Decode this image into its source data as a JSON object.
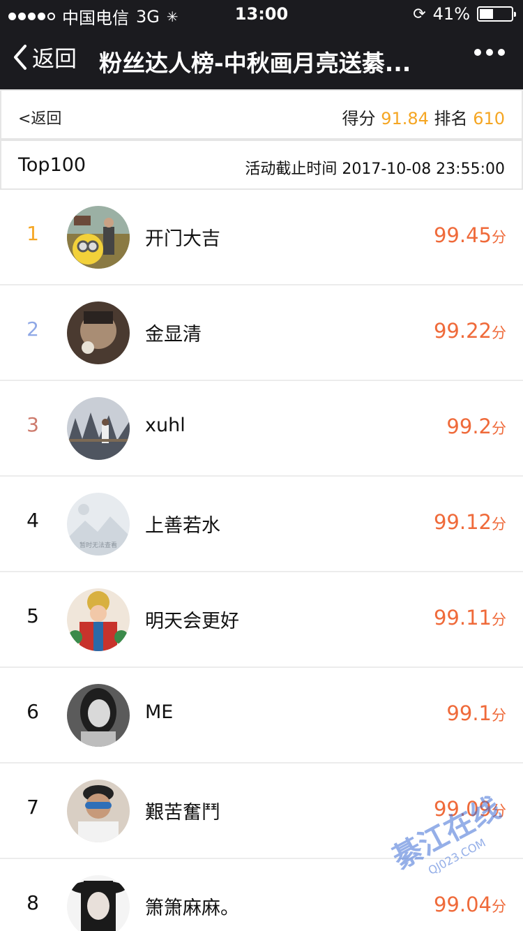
{
  "status_bar": {
    "carrier": "中国电信",
    "network": "3G",
    "time": "13:00",
    "battery": "41%",
    "battery_level": 0.41
  },
  "nav": {
    "back_label": "返回",
    "title": "粉丝达人榜-中秋画月亮送綦..."
  },
  "score_bar": {
    "back_link": "<返回",
    "score_label": "得分",
    "score_value": "91.84",
    "rank_label": "排名",
    "rank_value": "610"
  },
  "top_bar": {
    "label": "Top100",
    "deadline": "活动截止时间 2017-10-08 23:55:00"
  },
  "ranking": [
    {
      "rank": "1",
      "name": "开门大吉",
      "score": "99.45",
      "unit": "分"
    },
    {
      "rank": "2",
      "name": "金显清",
      "score": "99.22",
      "unit": "分"
    },
    {
      "rank": "3",
      "name": "xuhl",
      "score": "99.2",
      "unit": "分"
    },
    {
      "rank": "4",
      "name": "上善若水",
      "score": "99.12",
      "unit": "分",
      "avatar_text": "暂时无法查看"
    },
    {
      "rank": "5",
      "name": "明天会更好",
      "score": "99.11",
      "unit": "分"
    },
    {
      "rank": "6",
      "name": "ME",
      "score": "99.1",
      "unit": "分"
    },
    {
      "rank": "7",
      "name": "艱苦奮鬥",
      "score": "99.09",
      "unit": "分"
    },
    {
      "rank": "8",
      "name": "箫箫麻麻。",
      "score": "99.04",
      "unit": "分"
    }
  ],
  "watermark": {
    "text": "綦江在线",
    "url": "QJ023.COM"
  },
  "colors": {
    "bar_bg": "#1b1b1f",
    "accent": "#f5a623",
    "score": "#ef6a3a",
    "rank2": "#8fa8e6",
    "rank3": "#cd7a6c"
  }
}
